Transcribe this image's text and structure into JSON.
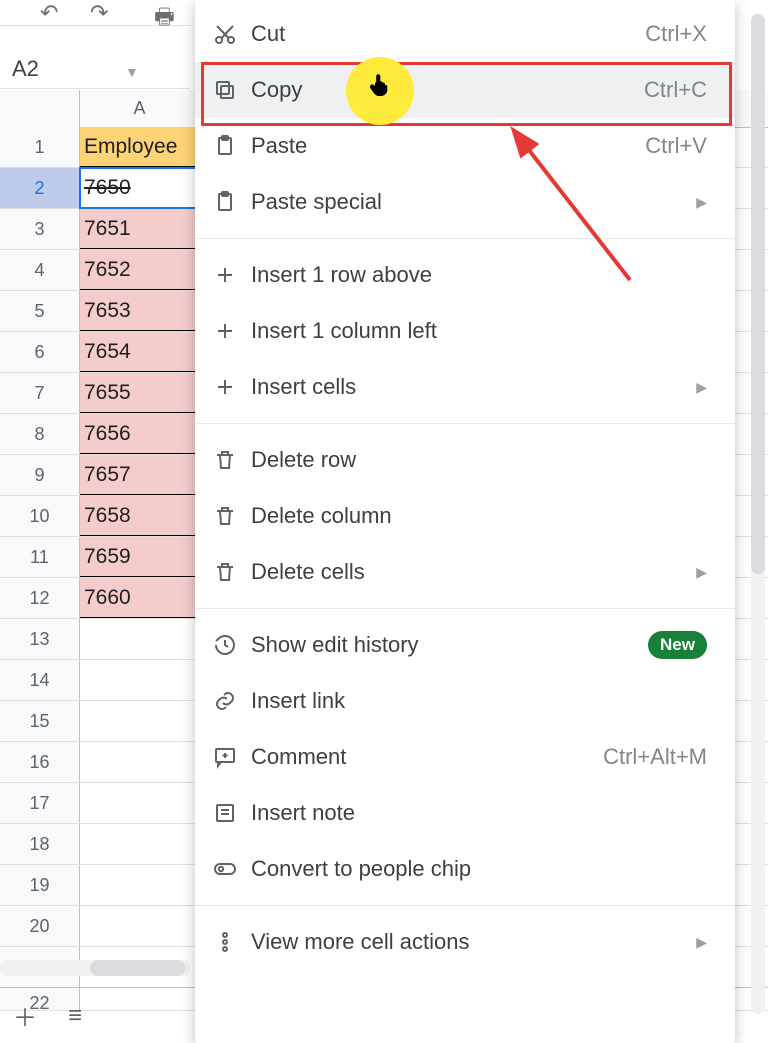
{
  "nameBox": {
    "value": "A2"
  },
  "columns": {
    "A": "A"
  },
  "rows": [
    {
      "n": "1",
      "v": "Employee",
      "hdr": true
    },
    {
      "n": "2",
      "v": "7650",
      "strike": true,
      "sel": true
    },
    {
      "n": "3",
      "v": "7651",
      "pink": true
    },
    {
      "n": "4",
      "v": "7652",
      "pink": true
    },
    {
      "n": "5",
      "v": "7653",
      "pink": true
    },
    {
      "n": "6",
      "v": "7654",
      "pink": true
    },
    {
      "n": "7",
      "v": "7655",
      "pink": true
    },
    {
      "n": "8",
      "v": "7656",
      "pink": true
    },
    {
      "n": "9",
      "v": "7657",
      "pink": true
    },
    {
      "n": "10",
      "v": "7658",
      "pink": true
    },
    {
      "n": "11",
      "v": "7659",
      "pink": true
    },
    {
      "n": "12",
      "v": "7660",
      "pink": true
    },
    {
      "n": "13",
      "v": ""
    },
    {
      "n": "14",
      "v": ""
    },
    {
      "n": "15",
      "v": ""
    },
    {
      "n": "16",
      "v": ""
    },
    {
      "n": "17",
      "v": ""
    },
    {
      "n": "18",
      "v": ""
    },
    {
      "n": "19",
      "v": ""
    },
    {
      "n": "20",
      "v": ""
    },
    {
      "n": "21",
      "v": ""
    },
    {
      "n": "22",
      "v": ""
    }
  ],
  "colors": {
    "headerFill": "#fdd375",
    "pinkFill": "#f4cccc"
  },
  "menu": {
    "items": [
      {
        "icon": "cut",
        "label": "Cut",
        "shortcut": "Ctrl+X"
      },
      {
        "icon": "copy",
        "label": "Copy",
        "shortcut": "Ctrl+C",
        "hl": true
      },
      {
        "icon": "paste",
        "label": "Paste",
        "shortcut": "Ctrl+V"
      },
      {
        "icon": "paste",
        "label": "Paste special",
        "arrow": true
      },
      {
        "sep": true
      },
      {
        "icon": "plus",
        "label": "Insert 1 row above"
      },
      {
        "icon": "plus",
        "label": "Insert 1 column left"
      },
      {
        "icon": "plus",
        "label": "Insert cells",
        "arrow": true
      },
      {
        "sep": true
      },
      {
        "icon": "trash",
        "label": "Delete row"
      },
      {
        "icon": "trash",
        "label": "Delete column"
      },
      {
        "icon": "trash",
        "label": "Delete cells",
        "arrow": true
      },
      {
        "sep": true
      },
      {
        "icon": "history",
        "label": "Show edit history",
        "badge": "New"
      },
      {
        "icon": "link",
        "label": "Insert link"
      },
      {
        "icon": "comment",
        "label": "Comment",
        "shortcut": "Ctrl+Alt+M"
      },
      {
        "icon": "note",
        "label": "Insert note"
      },
      {
        "icon": "people",
        "label": "Convert to people chip"
      },
      {
        "sep": true
      },
      {
        "icon": "dots",
        "label": "View more cell actions",
        "arrow": true
      }
    ]
  }
}
